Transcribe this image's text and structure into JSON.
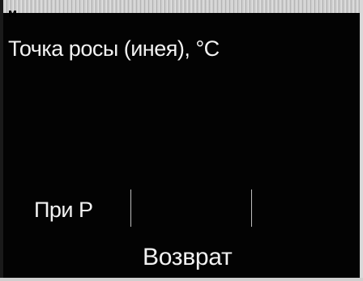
{
  "display": {
    "corner_mark": "M",
    "heading": "Точка росы (инея), °C",
    "pressure_label": "При P",
    "pressure_value": "",
    "back_label": "Возврат"
  }
}
